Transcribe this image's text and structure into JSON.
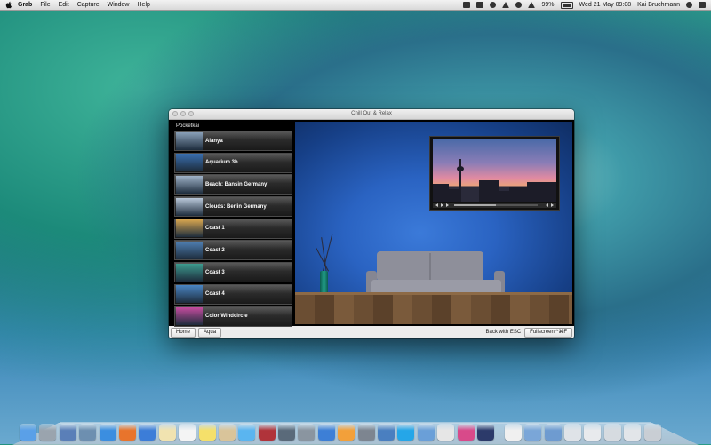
{
  "menubar": {
    "app_name": "Grab",
    "menus": [
      "File",
      "Edit",
      "Capture",
      "Window",
      "Help"
    ],
    "battery": "99%",
    "datetime": "Wed 21 May  09:08",
    "user": "Kai Bruchmann"
  },
  "window": {
    "title": "Chill Out & Relax",
    "sidebar_title": "Pocketkai",
    "items": [
      {
        "label": "Alanya",
        "thumb_color": "#8aa0b8"
      },
      {
        "label": "Aquarium 3h",
        "thumb_color": "#3a6fb0"
      },
      {
        "label": "Beach: Bansin Germany",
        "thumb_color": "#9fb3c9"
      },
      {
        "label": "Clouds: Berlin Germany",
        "thumb_color": "#b9c8da"
      },
      {
        "label": "Coast 1",
        "thumb_color": "#d8a650"
      },
      {
        "label": "Coast 2",
        "thumb_color": "#4f7fb2"
      },
      {
        "label": "Coast 3",
        "thumb_color": "#3d9b8e"
      },
      {
        "label": "Coast 4",
        "thumb_color": "#4a86c4"
      },
      {
        "label": "Color Windcircle",
        "thumb_color": "#c54ca0"
      }
    ],
    "buttons": {
      "home": "Home",
      "aqua": "Aqua",
      "fullscreen": "Fullscreen ^⌘F"
    },
    "hint": "Back with ESC",
    "player_progress": 0.5
  },
  "dock": {
    "icons": [
      {
        "name": "finder",
        "color": "#5aa0e8"
      },
      {
        "name": "launchpad",
        "color": "#9aa4ae"
      },
      {
        "name": "mission-control",
        "color": "#5a7fb8"
      },
      {
        "name": "preview",
        "color": "#6d8fb0"
      },
      {
        "name": "safari",
        "color": "#3b8ee0"
      },
      {
        "name": "firefox",
        "color": "#e8742c"
      },
      {
        "name": "iphoto",
        "color": "#3c7dd8"
      },
      {
        "name": "notes",
        "color": "#f1e3b0"
      },
      {
        "name": "calendar",
        "color": "#f4f4f4"
      },
      {
        "name": "stickies",
        "color": "#f5e06a"
      },
      {
        "name": "contacts",
        "color": "#d9c49a"
      },
      {
        "name": "messages",
        "color": "#5ab5f0"
      },
      {
        "name": "photo-booth",
        "color": "#b0333a"
      },
      {
        "name": "image-capture",
        "color": "#5a6a7a"
      },
      {
        "name": "grapher",
        "color": "#8a95a0"
      },
      {
        "name": "itunes",
        "color": "#3d7fd6"
      },
      {
        "name": "ibooks",
        "color": "#f2a03a"
      },
      {
        "name": "system-preferences",
        "color": "#7d8590"
      },
      {
        "name": "xcode",
        "color": "#4a7fc0"
      },
      {
        "name": "skype",
        "color": "#25a6e8"
      },
      {
        "name": "app-store",
        "color": "#6a9fd8"
      },
      {
        "name": "chess",
        "color": "#e6e6e6"
      },
      {
        "name": "photoshop",
        "color": "#d84a8a"
      },
      {
        "name": "itunes-store",
        "color": "#2c3a6a"
      },
      {
        "name": "document",
        "color": "#f0f0f0"
      },
      {
        "name": "folder",
        "color": "#7aa6d8"
      },
      {
        "name": "downloads",
        "color": "#6e9bd0"
      },
      {
        "name": "stack-1",
        "color": "#dfe3e8"
      },
      {
        "name": "stack-2",
        "color": "#e8eaed"
      },
      {
        "name": "stack-3",
        "color": "#d6dbe0"
      },
      {
        "name": "stack-4",
        "color": "#e2e5e9"
      },
      {
        "name": "trash",
        "color": "#c9ced4"
      }
    ]
  }
}
